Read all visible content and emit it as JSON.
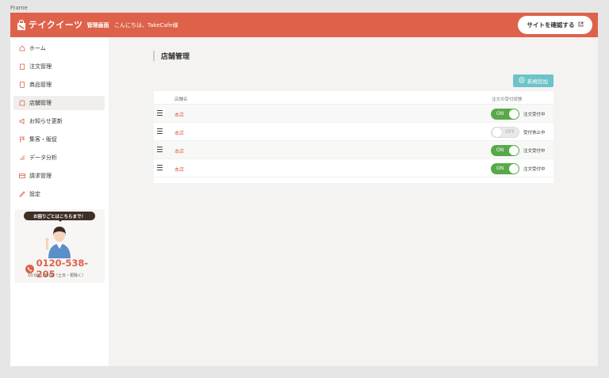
{
  "frame_label": "Frame",
  "header": {
    "logo_text": "テイクイーツ",
    "logo_sub": "管理画面",
    "greeting": "こんにちは、TakeCafe様",
    "site_button": "サイトを確認する",
    "accent_color": "#de624a"
  },
  "sidebar": {
    "items": [
      {
        "label": "ホーム",
        "icon": "home-icon"
      },
      {
        "label": "注文管理",
        "icon": "clipboard-icon"
      },
      {
        "label": "商品管理",
        "icon": "book-icon"
      },
      {
        "label": "店舗管理",
        "icon": "store-icon",
        "active": true
      },
      {
        "label": "お知らせ更新",
        "icon": "megaphone-icon"
      },
      {
        "label": "集客・販促",
        "icon": "flag-icon"
      },
      {
        "label": "データ分析",
        "icon": "bar-chart-icon"
      },
      {
        "label": "請求管理",
        "icon": "card-icon"
      },
      {
        "label": "設定",
        "icon": "pencil-icon"
      }
    ],
    "help": {
      "bubble": "お困りごとはこちらまで！",
      "phone": "0120-538-205",
      "hours": "10:00~18:00（土日・祝除く）"
    }
  },
  "main": {
    "title": "店舗管理",
    "add_button": "新規追加",
    "table": {
      "col_name": "店舗名",
      "col_status": "注文の受付状態",
      "rows": [
        {
          "name": "本店",
          "toggle": "ON",
          "on": true,
          "status": "注文受付中"
        },
        {
          "name": "本店",
          "toggle": "OFF",
          "on": false,
          "status": "受付休止中"
        },
        {
          "name": "本店",
          "toggle": "ON",
          "on": true,
          "status": "注文受付中"
        },
        {
          "name": "本店",
          "toggle": "ON",
          "on": true,
          "status": "注文受付中"
        }
      ]
    }
  }
}
